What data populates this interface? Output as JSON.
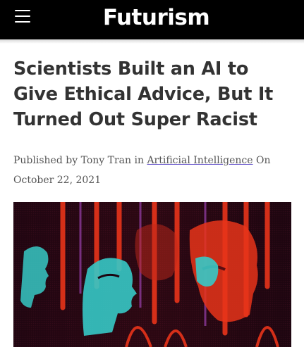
{
  "header": {
    "logo_text": "Futurism",
    "menu_icon": "hamburger-menu-icon",
    "background": "#000000"
  },
  "article": {
    "title": "Scientists Built an AI to Give Ethical Advice, But It Turned Out Super Racist",
    "byline": {
      "prefix": "Published by",
      "author": "Tony Tran",
      "in_word": "in",
      "category": "Artificial Intelligence",
      "on_word": "On",
      "date": "October 22, 2021"
    }
  },
  "colors": {
    "title_text": "#333333",
    "byline_text": "#555555",
    "link_underline": "#6a5acd",
    "hero_red": "#e8341a",
    "hero_cyan": "#36c9c6",
    "hero_dark": "#1c0510"
  }
}
